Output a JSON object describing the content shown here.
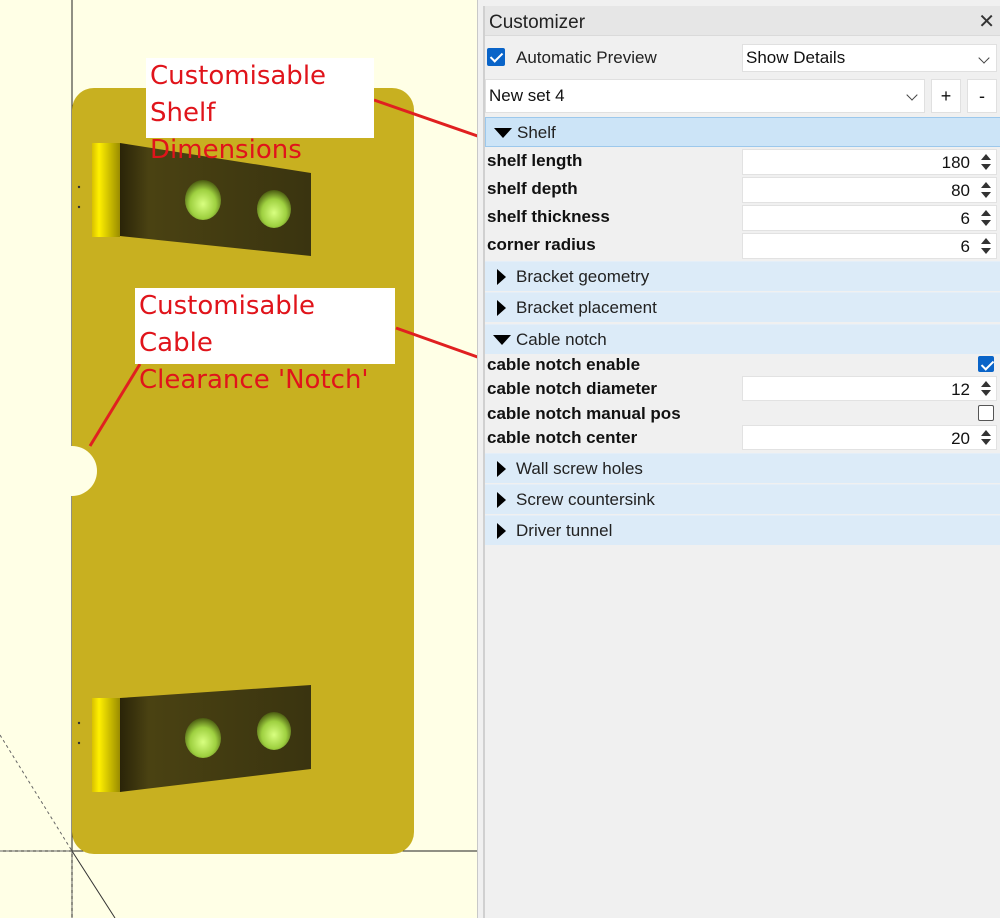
{
  "viewport": {
    "callouts": {
      "shelf": "Customisable\nShelf Dimensions",
      "notch": "Customisable Cable\nClearance 'Notch'"
    },
    "colors": {
      "background": "#ffffe6",
      "plate": "#c8b020",
      "face": "#3b3410",
      "hole": "#b5e060",
      "callout_text": "#e0141b",
      "leader_line": "#e02020"
    }
  },
  "customizer": {
    "title": "Customizer",
    "close_icon": "close-icon",
    "automatic_preview": {
      "label": "Automatic Preview",
      "checked": true
    },
    "details_select": {
      "value": "Show Details"
    },
    "preset_select": {
      "value": "New set 4"
    },
    "add_label": "+",
    "remove_label": "-",
    "groups": [
      {
        "label": "Shelf",
        "expanded": true,
        "params": [
          {
            "label": "shelf length",
            "value": "180"
          },
          {
            "label": "shelf depth",
            "value": "80"
          },
          {
            "label": "shelf thickness",
            "value": "6"
          },
          {
            "label": "corner radius",
            "value": "6"
          }
        ]
      },
      {
        "label": "Bracket geometry",
        "expanded": false
      },
      {
        "label": "Bracket placement",
        "expanded": false
      },
      {
        "label": "Cable notch",
        "expanded": true,
        "params": [
          {
            "label": "cable notch enable",
            "type": "checkbox",
            "checked": true
          },
          {
            "label": "cable notch diameter",
            "value": "12"
          },
          {
            "label": "cable notch manual pos",
            "type": "checkbox",
            "checked": false
          },
          {
            "label": "cable notch center",
            "value": "20"
          }
        ]
      },
      {
        "label": "Wall screw holes",
        "expanded": false
      },
      {
        "label": "Screw countersink",
        "expanded": false
      },
      {
        "label": "Driver tunnel",
        "expanded": false
      }
    ],
    "colors": {
      "accent": "#0a64c8",
      "group_header": "#dcebf8",
      "group_header_open": "#cce4f7"
    }
  }
}
